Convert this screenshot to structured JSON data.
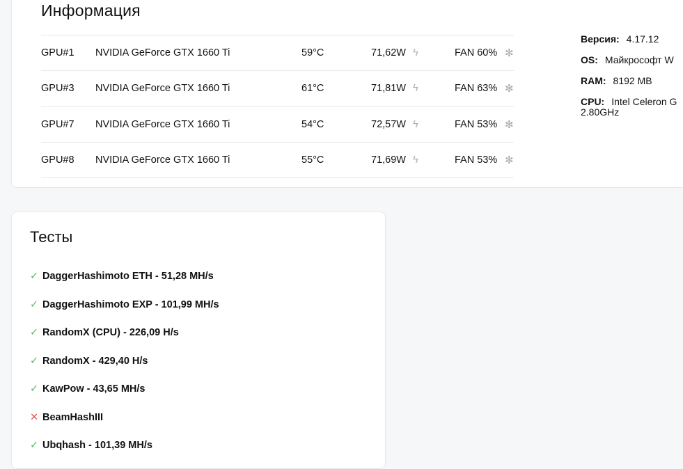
{
  "info": {
    "title": "Информация",
    "gpus": [
      {
        "id": "GPU#1",
        "name": "NVIDIA GeForce GTX 1660 Ti",
        "temp": "59°C",
        "power": "71,62W",
        "fan": "FAN 60%"
      },
      {
        "id": "GPU#3",
        "name": "NVIDIA GeForce GTX 1660 Ti",
        "temp": "61°C",
        "power": "71,81W",
        "fan": "FAN 63%"
      },
      {
        "id": "GPU#7",
        "name": "NVIDIA GeForce GTX 1660 Ti",
        "temp": "54°C",
        "power": "72,57W",
        "fan": "FAN 53%"
      },
      {
        "id": "GPU#8",
        "name": "NVIDIA GeForce GTX 1660 Ti",
        "temp": "55°C",
        "power": "71,69W",
        "fan": "FAN 53%"
      }
    ],
    "system": {
      "version_label": "Версия:",
      "version": "4.17.12",
      "os_label": "OS:",
      "os": "Майкрософт W",
      "ram_label": "RAM:",
      "ram": "8192 MB",
      "cpu_label": "CPU:",
      "cpu": "Intel Celeron G",
      "cpu_freq": "2.80GHz"
    }
  },
  "tests": {
    "title": "Тесты",
    "items": [
      {
        "label": "DaggerHashimoto ETH - 51,28 MH/s",
        "status": "ok"
      },
      {
        "label": "DaggerHashimoto EXP - 101,99 MH/s",
        "status": "ok"
      },
      {
        "label": "RandomX (CPU) - 226,09 H/s",
        "status": "ok"
      },
      {
        "label": "RandomX - 429,40 H/s",
        "status": "ok"
      },
      {
        "label": "KawPow - 43,65 MH/s",
        "status": "ok"
      },
      {
        "label": "BeamHashIII",
        "status": "fail"
      },
      {
        "label": "Ubqhash - 101,39 MH/s",
        "status": "ok"
      }
    ]
  },
  "colors": {
    "success": "#5bbb6a",
    "error": "#e05555",
    "icon_gray": "#a7abb2",
    "border": "#e6e8ec"
  },
  "icons": {
    "power": "bolt-icon",
    "fan": "fan-icon",
    "ok": "check-icon",
    "fail": "cross-icon"
  }
}
